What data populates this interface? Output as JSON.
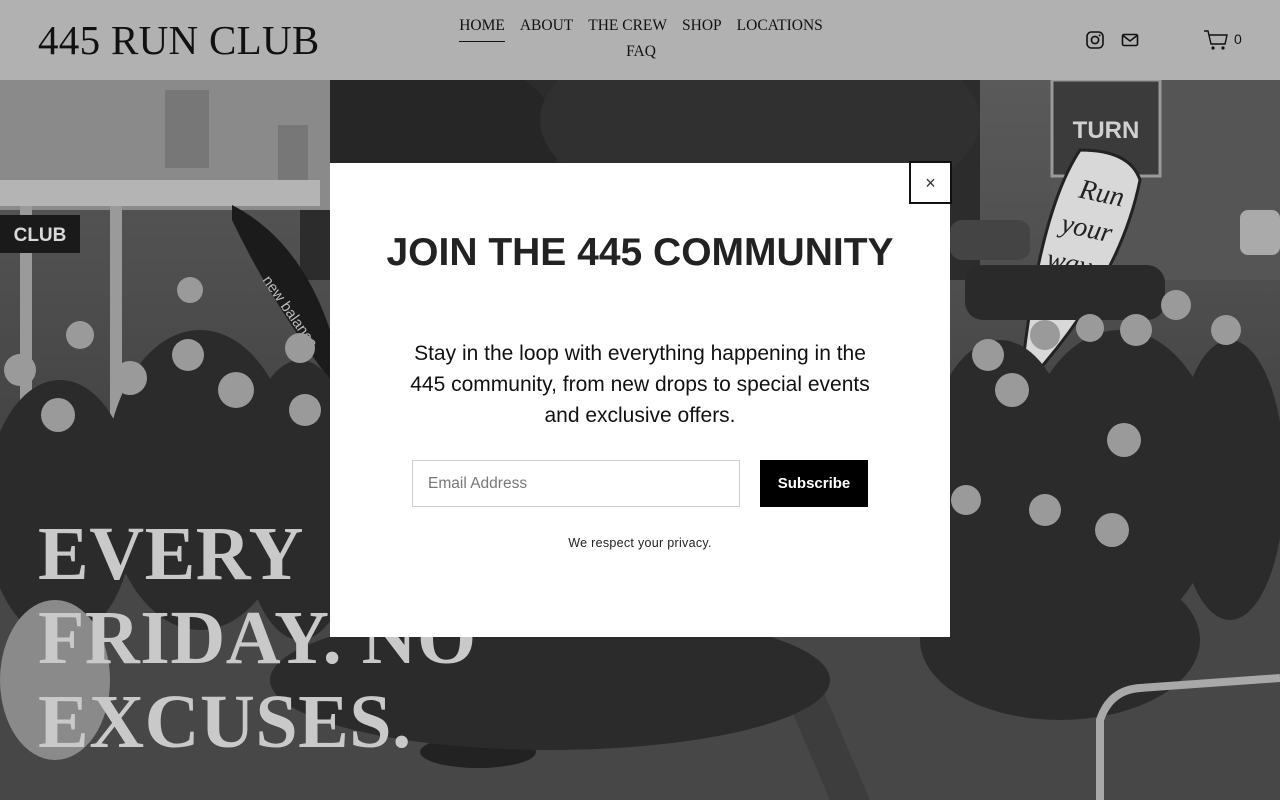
{
  "header": {
    "logo": "445 RUN CLUB",
    "nav": [
      {
        "label": "HOME",
        "active": true
      },
      {
        "label": "ABOUT",
        "active": false
      },
      {
        "label": "THE CREW",
        "active": false
      },
      {
        "label": "SHOP",
        "active": false
      },
      {
        "label": "LOCATIONS",
        "active": false
      },
      {
        "label": "FAQ",
        "active": false
      }
    ],
    "icons": [
      "instagram-icon",
      "email-icon",
      "cart-icon"
    ],
    "cart_count": "0"
  },
  "hero": {
    "headline_lines": [
      "EVERY",
      "FRIDAY. NO",
      "EXCUSES."
    ],
    "photo_signs": {
      "club_sign": "CLUB",
      "turn_sign": "TURN",
      "banner_brand": "new balance",
      "flag_text": [
        "Run",
        "your",
        "way."
      ]
    }
  },
  "modal": {
    "close_label": "×",
    "title": "JOIN THE 445 COMMUNITY",
    "body": "Stay in the loop with everything happening in the 445 community, from new drops to special events and exclusive offers.",
    "email_placeholder": "Email Address",
    "subscribe_label": "Subscribe",
    "privacy_note": "We respect your privacy."
  },
  "colors": {
    "header_bg": "#b1b1b1",
    "modal_bg": "#ffffff",
    "button_bg": "#000000",
    "headline": "#c9c9c9"
  }
}
